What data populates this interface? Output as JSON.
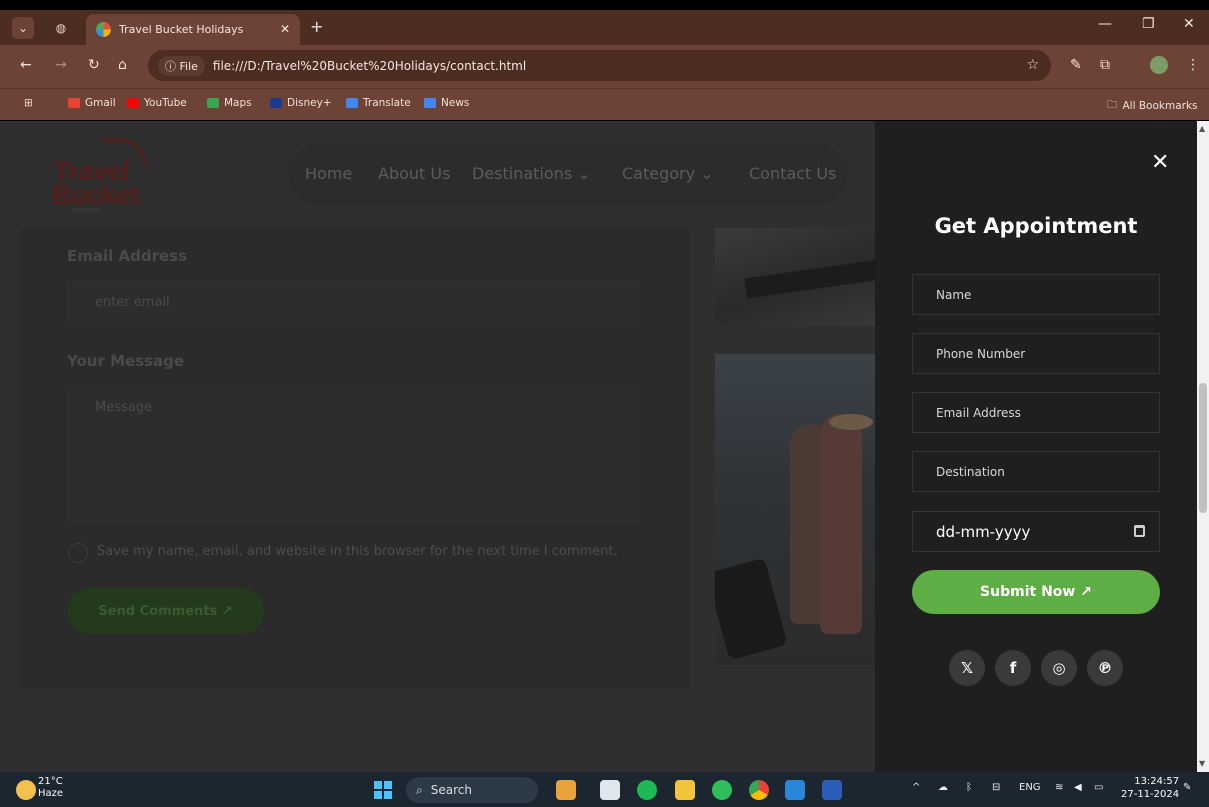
{
  "browser": {
    "tab_title": "Travel Bucket Holidays",
    "file_chip": "ⓘ File",
    "url": "file:///D:/Travel%20Bucket%20Holidays/contact.html",
    "bookmarks": [
      {
        "label": "Gmail",
        "color": "#ea4335"
      },
      {
        "label": "YouTube",
        "color": "#ff0000"
      },
      {
        "label": "Maps",
        "color": "#34a853"
      },
      {
        "label": "Disney+",
        "color": "#1a3c8f"
      },
      {
        "label": "Translate",
        "color": "#4285f4"
      },
      {
        "label": "News",
        "color": "#4285f4"
      }
    ],
    "all_bookmarks": "All Bookmarks"
  },
  "site": {
    "logo_line1": "Travel",
    "logo_line2": "Bucket",
    "logo_line3": "HOLIDAYS",
    "nav": [
      "Home",
      "About Us",
      "Destinations ⌄",
      "Category ⌄",
      "Contact Us"
    ]
  },
  "form": {
    "email_label": "Email Address",
    "email_placeholder": "enter email",
    "message_label": "Your Message",
    "message_placeholder": "Message",
    "save_checkbox_text": "Save my name, email, and website in this browser for the next time I comment.",
    "send_button": "Send Comments ↗"
  },
  "appointment": {
    "title": "Get Appointment",
    "close": "✕",
    "fields": [
      "Name",
      "Phone Number",
      "Email Address",
      "Destination"
    ],
    "date_placeholder": "dd-mm-yyyy",
    "submit": "Submit Now ↗",
    "social": [
      "twitter-icon",
      "facebook-icon",
      "instagram-icon",
      "pinterest-icon"
    ],
    "social_glyphs": [
      "𝕏",
      "f",
      "◎",
      "℗"
    ]
  },
  "taskbar": {
    "temp": "21°C",
    "weather": "Haze",
    "search": "Search",
    "lang": "ENG",
    "time": "13:24:57",
    "date": "27-11-2024"
  },
  "colors": {
    "accent": "#5fae45",
    "brand": "#551e1b",
    "chrome": "#6e4337"
  }
}
